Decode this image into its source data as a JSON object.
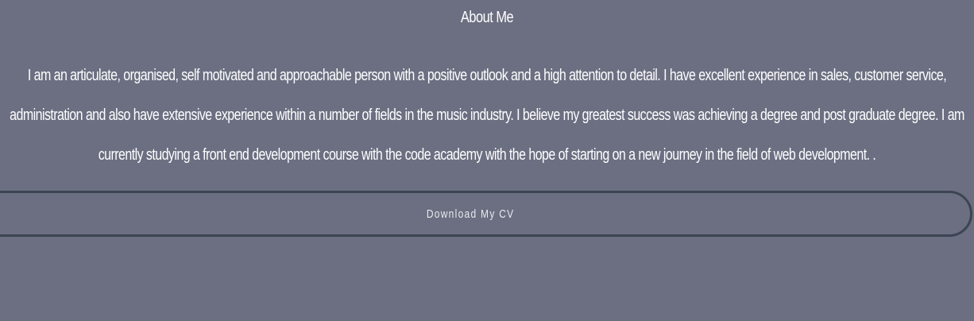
{
  "about": {
    "title": "About Me",
    "lines": [
      "I am an articulate, organised, self motivated and approachable person with a positive outlook and a high attention to detail. I have excellent experience in sales, customer service,",
      "administration and also have extensive experience within a number of fields in the music industry. I believe my greatest success was achieving a degree and post graduate degree. I am",
      "currently studying a front end development course with the code academy with the hope of starting on a new journey in the field of web development. ."
    ],
    "button_label": "Download My CV"
  },
  "colors": {
    "background": "#6b6f81",
    "button_border": "#3d4452",
    "text": "#ffffff"
  }
}
